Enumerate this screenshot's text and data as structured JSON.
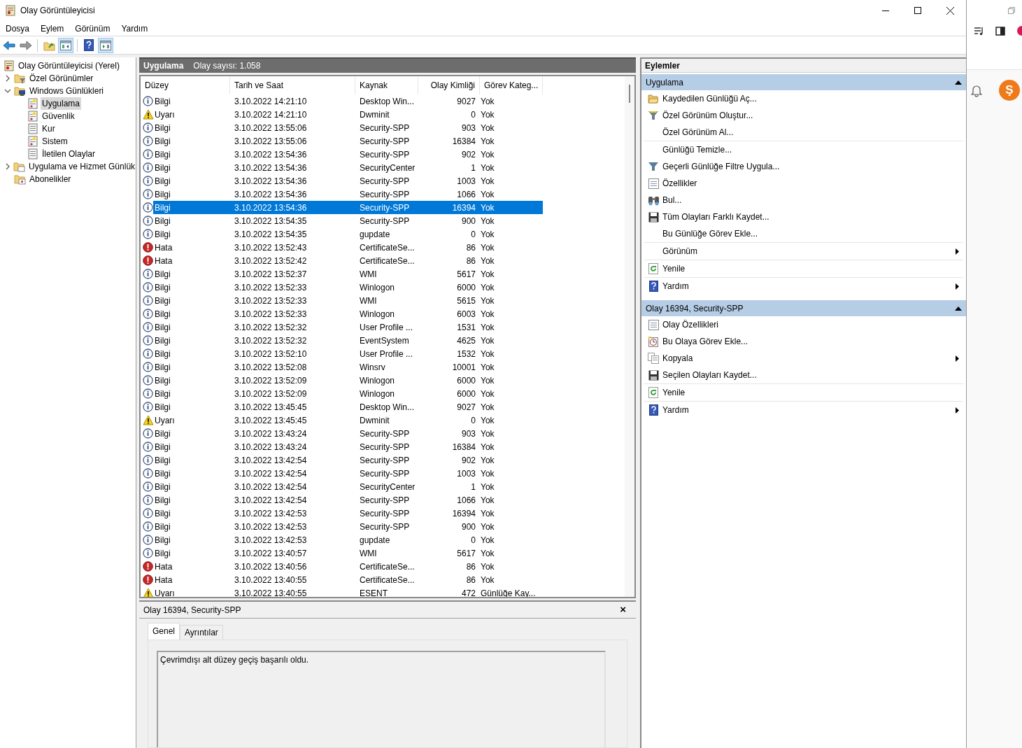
{
  "window": {
    "title": "Olay Görüntüleyicisi"
  },
  "menu": [
    "Dosya",
    "Eylem",
    "Görünüm",
    "Yardım"
  ],
  "toolbar": [
    {
      "kind": "back",
      "pressed": false
    },
    {
      "kind": "forward",
      "pressed": false
    },
    {
      "kind": "separator"
    },
    {
      "kind": "up",
      "pressed": false
    },
    {
      "kind": "tree",
      "pressed": true
    },
    {
      "kind": "separator"
    },
    {
      "kind": "help",
      "pressed": false
    },
    {
      "kind": "actions",
      "pressed": true
    }
  ],
  "tree": [
    {
      "label": "Olay Görüntüleyicisi (Yerel)",
      "kind": "root",
      "selected": false,
      "children": [
        {
          "label": "Özel Görünümler",
          "kind": "folder-filter",
          "expanded": false,
          "selected": false
        },
        {
          "label": "Windows Günlükleri",
          "kind": "folder-logs",
          "expanded": true,
          "selected": false,
          "children": [
            {
              "label": "Uygulama",
              "kind": "log-alert",
              "selected": true
            },
            {
              "label": "Güvenlik",
              "kind": "log-alert",
              "selected": false
            },
            {
              "label": "Kur",
              "kind": "log",
              "selected": false
            },
            {
              "label": "Sistem",
              "kind": "log-alert",
              "selected": false
            },
            {
              "label": "İletilen Olaylar",
              "kind": "log",
              "selected": false
            }
          ]
        },
        {
          "label": "Uygulama ve Hizmet Günlük",
          "kind": "folder",
          "expanded": false,
          "selected": false
        },
        {
          "label": "Abonelikler",
          "kind": "folder-sub",
          "selected": false
        }
      ]
    }
  ],
  "center": {
    "title": "Uygulama",
    "count": "Olay sayısı: 1.058"
  },
  "table": {
    "columns": [
      "Düzey",
      "Tarih ve Saat",
      "Kaynak",
      "Olay Kimliği",
      "Görev Kateg..."
    ],
    "rows": [
      {
        "kind": "info",
        "severity": "Bilgi",
        "date": "3.10.2022 14:21:10",
        "source": "Desktop Win...",
        "event_id": "9027",
        "category": "Yok",
        "selected": false
      },
      {
        "kind": "warning",
        "severity": "Uyarı",
        "date": "3.10.2022 14:21:10",
        "source": "Dwminit",
        "event_id": "0",
        "category": "Yok",
        "selected": false
      },
      {
        "kind": "info",
        "severity": "Bilgi",
        "date": "3.10.2022 13:55:06",
        "source": "Security-SPP",
        "event_id": "903",
        "category": "Yok",
        "selected": false
      },
      {
        "kind": "info",
        "severity": "Bilgi",
        "date": "3.10.2022 13:55:06",
        "source": "Security-SPP",
        "event_id": "16384",
        "category": "Yok",
        "selected": false
      },
      {
        "kind": "info",
        "severity": "Bilgi",
        "date": "3.10.2022 13:54:36",
        "source": "Security-SPP",
        "event_id": "902",
        "category": "Yok",
        "selected": false
      },
      {
        "kind": "info",
        "severity": "Bilgi",
        "date": "3.10.2022 13:54:36",
        "source": "SecurityCenter",
        "event_id": "1",
        "category": "Yok",
        "selected": false
      },
      {
        "kind": "info",
        "severity": "Bilgi",
        "date": "3.10.2022 13:54:36",
        "source": "Security-SPP",
        "event_id": "1003",
        "category": "Yok",
        "selected": false
      },
      {
        "kind": "info",
        "severity": "Bilgi",
        "date": "3.10.2022 13:54:36",
        "source": "Security-SPP",
        "event_id": "1066",
        "category": "Yok",
        "selected": false
      },
      {
        "kind": "info",
        "severity": "Bilgi",
        "date": "3.10.2022 13:54:36",
        "source": "Security-SPP",
        "event_id": "16394",
        "category": "Yok",
        "selected": true
      },
      {
        "kind": "info",
        "severity": "Bilgi",
        "date": "3.10.2022 13:54:35",
        "source": "Security-SPP",
        "event_id": "900",
        "category": "Yok",
        "selected": false
      },
      {
        "kind": "info",
        "severity": "Bilgi",
        "date": "3.10.2022 13:54:35",
        "source": "gupdate",
        "event_id": "0",
        "category": "Yok",
        "selected": false
      },
      {
        "kind": "error",
        "severity": "Hata",
        "date": "3.10.2022 13:52:43",
        "source": "CertificateSe...",
        "event_id": "86",
        "category": "Yok",
        "selected": false
      },
      {
        "kind": "error",
        "severity": "Hata",
        "date": "3.10.2022 13:52:42",
        "source": "CertificateSe...",
        "event_id": "86",
        "category": "Yok",
        "selected": false
      },
      {
        "kind": "info",
        "severity": "Bilgi",
        "date": "3.10.2022 13:52:37",
        "source": "WMI",
        "event_id": "5617",
        "category": "Yok",
        "selected": false
      },
      {
        "kind": "info",
        "severity": "Bilgi",
        "date": "3.10.2022 13:52:33",
        "source": "Winlogon",
        "event_id": "6000",
        "category": "Yok",
        "selected": false
      },
      {
        "kind": "info",
        "severity": "Bilgi",
        "date": "3.10.2022 13:52:33",
        "source": "WMI",
        "event_id": "5615",
        "category": "Yok",
        "selected": false
      },
      {
        "kind": "info",
        "severity": "Bilgi",
        "date": "3.10.2022 13:52:33",
        "source": "Winlogon",
        "event_id": "6003",
        "category": "Yok",
        "selected": false
      },
      {
        "kind": "info",
        "severity": "Bilgi",
        "date": "3.10.2022 13:52:32",
        "source": "User Profile ...",
        "event_id": "1531",
        "category": "Yok",
        "selected": false
      },
      {
        "kind": "info",
        "severity": "Bilgi",
        "date": "3.10.2022 13:52:32",
        "source": "EventSystem",
        "event_id": "4625",
        "category": "Yok",
        "selected": false
      },
      {
        "kind": "info",
        "severity": "Bilgi",
        "date": "3.10.2022 13:52:10",
        "source": "User Profile ...",
        "event_id": "1532",
        "category": "Yok",
        "selected": false
      },
      {
        "kind": "info",
        "severity": "Bilgi",
        "date": "3.10.2022 13:52:08",
        "source": "Winsrv",
        "event_id": "10001",
        "category": "Yok",
        "selected": false
      },
      {
        "kind": "info",
        "severity": "Bilgi",
        "date": "3.10.2022 13:52:09",
        "source": "Winlogon",
        "event_id": "6000",
        "category": "Yok",
        "selected": false
      },
      {
        "kind": "info",
        "severity": "Bilgi",
        "date": "3.10.2022 13:52:09",
        "source": "Winlogon",
        "event_id": "6000",
        "category": "Yok",
        "selected": false
      },
      {
        "kind": "info",
        "severity": "Bilgi",
        "date": "3.10.2022 13:45:45",
        "source": "Desktop Win...",
        "event_id": "9027",
        "category": "Yok",
        "selected": false
      },
      {
        "kind": "warning",
        "severity": "Uyarı",
        "date": "3.10.2022 13:45:45",
        "source": "Dwminit",
        "event_id": "0",
        "category": "Yok",
        "selected": false
      },
      {
        "kind": "info",
        "severity": "Bilgi",
        "date": "3.10.2022 13:43:24",
        "source": "Security-SPP",
        "event_id": "903",
        "category": "Yok",
        "selected": false
      },
      {
        "kind": "info",
        "severity": "Bilgi",
        "date": "3.10.2022 13:43:24",
        "source": "Security-SPP",
        "event_id": "16384",
        "category": "Yok",
        "selected": false
      },
      {
        "kind": "info",
        "severity": "Bilgi",
        "date": "3.10.2022 13:42:54",
        "source": "Security-SPP",
        "event_id": "902",
        "category": "Yok",
        "selected": false
      },
      {
        "kind": "info",
        "severity": "Bilgi",
        "date": "3.10.2022 13:42:54",
        "source": "Security-SPP",
        "event_id": "1003",
        "category": "Yok",
        "selected": false
      },
      {
        "kind": "info",
        "severity": "Bilgi",
        "date": "3.10.2022 13:42:54",
        "source": "SecurityCenter",
        "event_id": "1",
        "category": "Yok",
        "selected": false
      },
      {
        "kind": "info",
        "severity": "Bilgi",
        "date": "3.10.2022 13:42:54",
        "source": "Security-SPP",
        "event_id": "1066",
        "category": "Yok",
        "selected": false
      },
      {
        "kind": "info",
        "severity": "Bilgi",
        "date": "3.10.2022 13:42:53",
        "source": "Security-SPP",
        "event_id": "16394",
        "category": "Yok",
        "selected": false
      },
      {
        "kind": "info",
        "severity": "Bilgi",
        "date": "3.10.2022 13:42:53",
        "source": "Security-SPP",
        "event_id": "900",
        "category": "Yok",
        "selected": false
      },
      {
        "kind": "info",
        "severity": "Bilgi",
        "date": "3.10.2022 13:42:53",
        "source": "gupdate",
        "event_id": "0",
        "category": "Yok",
        "selected": false
      },
      {
        "kind": "info",
        "severity": "Bilgi",
        "date": "3.10.2022 13:40:57",
        "source": "WMI",
        "event_id": "5617",
        "category": "Yok",
        "selected": false
      },
      {
        "kind": "error",
        "severity": "Hata",
        "date": "3.10.2022 13:40:56",
        "source": "CertificateSe...",
        "event_id": "86",
        "category": "Yok",
        "selected": false
      },
      {
        "kind": "error",
        "severity": "Hata",
        "date": "3.10.2022 13:40:55",
        "source": "CertificateSe...",
        "event_id": "86",
        "category": "Yok",
        "selected": false
      },
      {
        "kind": "warning",
        "severity": "Uyarı",
        "date": "3.10.2022 13:40:55",
        "source": "ESENT",
        "event_id": "472",
        "category": "Günlüğe Kay...",
        "selected": false
      }
    ]
  },
  "details": {
    "title": "Olay 16394, Security-SPP",
    "close": "×",
    "tabs": [
      {
        "label": "Genel",
        "selected": true
      },
      {
        "label": "Ayrıntılar",
        "selected": false
      }
    ],
    "message": "Çevrimdışı alt düzey geçiş başarılı oldu."
  },
  "actions": {
    "title": "Eylemler",
    "sections": [
      {
        "title": "Uygulama",
        "expanded": true,
        "groups": [
          [
            {
              "label": "Kaydedilen Günlüğü Aç...",
              "kind": "open",
              "submenu": false
            },
            {
              "label": "Özel Görünüm Oluştur...",
              "kind": "create-view",
              "submenu": false
            },
            {
              "label": "Özel Görünüm Al...",
              "kind": "plain",
              "submenu": false
            }
          ],
          [
            {
              "label": "Günlüğü Temizle...",
              "kind": "plain",
              "submenu": false
            },
            {
              "label": "Geçerli Günlüğe Filtre Uygula...",
              "kind": "filter",
              "submenu": false
            },
            {
              "label": "Özellikler",
              "kind": "properties",
              "submenu": false
            },
            {
              "label": "Bul...",
              "kind": "find",
              "submenu": false
            },
            {
              "label": "Tüm Olayları Farklı Kaydet...",
              "kind": "save",
              "submenu": false
            },
            {
              "label": "Bu Günlüğe Görev Ekle...",
              "kind": "plain",
              "submenu": false
            }
          ],
          [
            {
              "label": "Görünüm",
              "kind": "plain",
              "submenu": true
            }
          ],
          [
            {
              "label": "Yenile",
              "kind": "refresh",
              "submenu": false
            }
          ],
          [
            {
              "label": "Yardım",
              "kind": "help",
              "submenu": true
            }
          ]
        ]
      },
      {
        "title": "Olay 16394, Security-SPP",
        "expanded": true,
        "groups": [
          [
            {
              "label": "Olay Özellikleri",
              "kind": "properties",
              "submenu": false
            },
            {
              "label": "Bu Olaya Görev Ekle...",
              "kind": "task",
              "submenu": false
            },
            {
              "label": "Kopyala",
              "kind": "copy",
              "submenu": true
            },
            {
              "label": "Seçilen Olayları Kaydet...",
              "kind": "save",
              "submenu": false
            }
          ],
          [
            {
              "label": "Yenile",
              "kind": "refresh",
              "submenu": false
            }
          ],
          [
            {
              "label": "Yardım",
              "kind": "help",
              "submenu": true
            }
          ]
        ]
      }
    ]
  },
  "background_window": {
    "avatar": "Ş"
  }
}
